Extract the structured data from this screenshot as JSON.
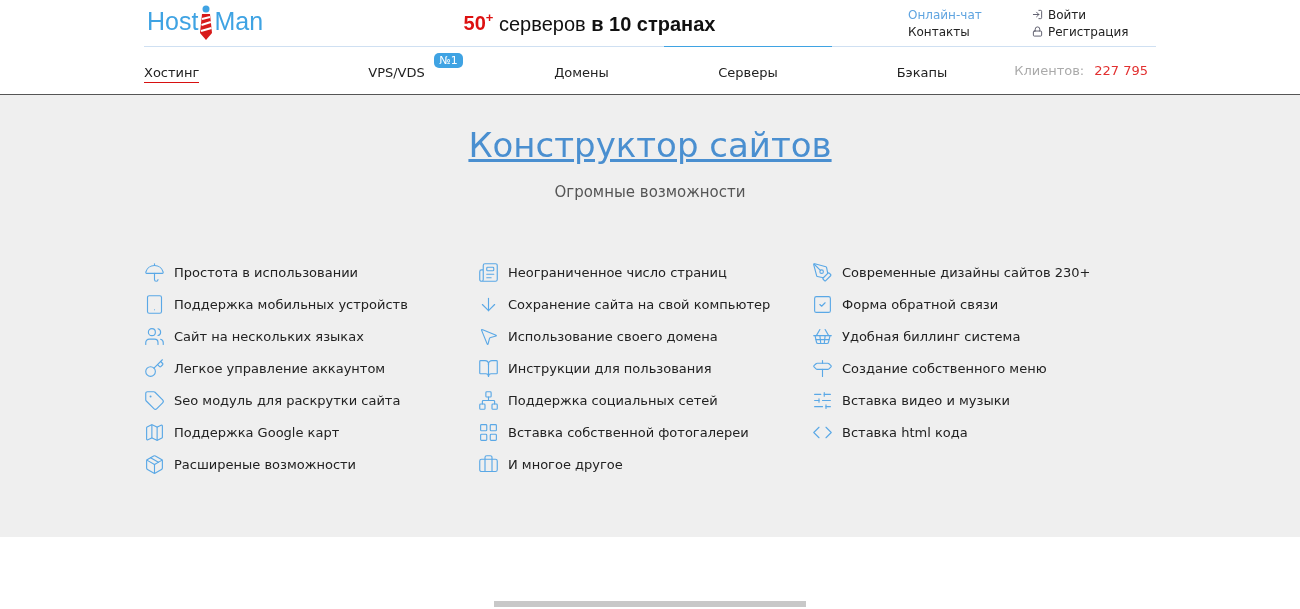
{
  "logo": {
    "left": "Host",
    "right": "Man"
  },
  "headline": {
    "count": "50",
    "count_sup": "+",
    "text": "серверов",
    "bold": "в 10 странах"
  },
  "top_links": [
    {
      "label": "Онлайн-чат",
      "kind": "accent"
    },
    {
      "label": "Контакты",
      "kind": "plain"
    }
  ],
  "account_links": [
    {
      "label": "Войти",
      "kind": "login"
    },
    {
      "label": "Регистрация",
      "kind": "register"
    }
  ],
  "nav": [
    {
      "label": "Хостинг",
      "selected": true,
      "hovered": false
    },
    {
      "label": "VPS/VDS",
      "selected": false,
      "hovered": false,
      "badge": "№1"
    },
    {
      "label": "Домены",
      "selected": false,
      "hovered": false
    },
    {
      "label": "Серверы",
      "selected": false,
      "hovered": true
    },
    {
      "label": "Бэкапы",
      "selected": false,
      "hovered": false
    }
  ],
  "clients": {
    "label": "Клиентов:",
    "value": "227 795"
  },
  "section": {
    "title": "Конструктор сайтов",
    "subtitle": "Огромные возможности"
  },
  "feature_columns": [
    [
      "Простота в использовании",
      "Поддержка мобильных устройств",
      "Сайт на нескольких языках",
      "Легкое управление аккаунтом",
      "Seo модуль для раскрутки сайта",
      "Поддержка Google карт",
      "Расширеные возможности"
    ],
    [
      "Неограниченное число страниц",
      "Сохранение сайта на свой компьютер",
      "Использование своего домена",
      "Инструкции для пользования",
      "Поддержка социальных сетей",
      "Вставка собственной фотогалереи",
      "И многое другое"
    ],
    [
      "Современные дизайны сайтов 230+",
      "Форма обратной связи",
      "Удобная биллинг система",
      "Создание собственного меню",
      "Вставка видео и музыки",
      "Вставка html кода"
    ]
  ]
}
